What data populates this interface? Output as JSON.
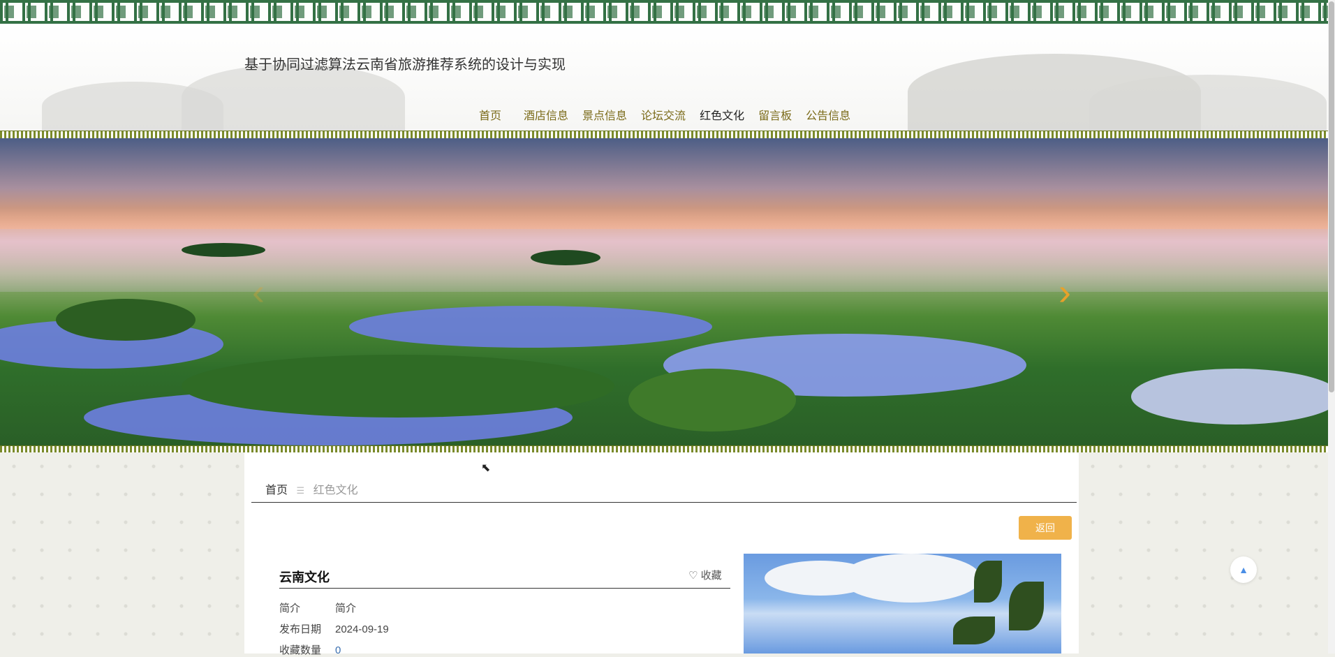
{
  "header": {
    "site_title": "基于协同过滤算法云南省旅游推荐系统的设计与实现",
    "nav": [
      {
        "label": "首页"
      },
      {
        "label": "酒店信息"
      },
      {
        "label": "景点信息"
      },
      {
        "label": "论坛交流"
      },
      {
        "label": "红色文化"
      },
      {
        "label": "留言板"
      },
      {
        "label": "公告信息"
      }
    ]
  },
  "banner": {
    "prev_icon": "chevron-left-icon",
    "next_icon": "chevron-right-icon",
    "prev_glyph": "‹",
    "next_glyph": "›"
  },
  "breadcrumb": {
    "home": "首页",
    "separator": "☰",
    "current": "红色文化"
  },
  "detail": {
    "back_label": "返回",
    "title": "云南文化",
    "favorite_label": "♡ 收藏",
    "rows": [
      {
        "key": "简介",
        "value": "简介"
      },
      {
        "key": "发布日期",
        "value": "2024-09-19"
      },
      {
        "key": "收藏数量",
        "value": "0"
      }
    ]
  },
  "to_top_glyph": "▲",
  "colors": {
    "accent": "#f0b24a",
    "nav_text": "#7a6a18",
    "border_green": "#2a6b3d"
  }
}
